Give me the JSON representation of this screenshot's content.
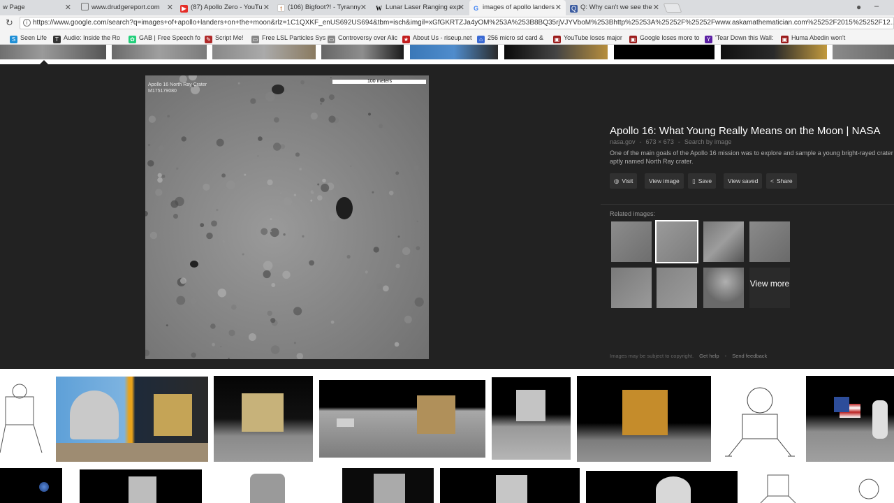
{
  "tabs": [
    {
      "label": "w Page",
      "icon": "blank-page-icon"
    },
    {
      "label": "www.drudgereport.com",
      "icon": "document-icon"
    },
    {
      "label": "(87) Apollo Zero - YouTu",
      "icon": "youtube-icon"
    },
    {
      "label": "(106) Bigfoot?! - Tyranny",
      "icon": "tumblr-icon"
    },
    {
      "label": "Lunar Laser Ranging exp",
      "icon": "wikipedia-icon"
    },
    {
      "label": "images of apollo landers",
      "icon": "google-icon"
    },
    {
      "label": "Q: Why can't we see the",
      "icon": "mathematician-icon"
    }
  ],
  "address": {
    "url": "https://www.google.com/search?q=images+of+apollo+landers+on+the+moon&rlz=1C1QXKF_enUS692US694&tbm=isch&imgil=xGfGKRTZJa4yOM%253A%253B8BQ35rjVJYVboM%253Bhttp%25253A%25252F%25252Fwww.askamathematician.com%25252F2015%25252F12..."
  },
  "bookmarks": [
    {
      "label": "Seen Life",
      "color": "#1e8fd6",
      "icon": "skype-icon"
    },
    {
      "label": "Audio: Inside the Ro",
      "color": "#333333",
      "icon": "t-logo-icon"
    },
    {
      "label": "GAB | Free Speech fo",
      "color": "#21cf7a",
      "icon": "gab-frog-icon"
    },
    {
      "label": "Script Me!",
      "color": "#b02a2a",
      "icon": "script-icon"
    },
    {
      "label": "Free LSL Particles Sys",
      "color": "#888888",
      "icon": "page-icon"
    },
    {
      "label": "Controversy over Alic",
      "color": "#888888",
      "icon": "page-icon"
    },
    {
      "label": "About Us - riseup.net",
      "color": "#c31d1d",
      "icon": "riseup-star-icon"
    },
    {
      "label": "256 micro sd card &",
      "color": "#3a6ad4",
      "icon": "home-icon"
    },
    {
      "label": "YouTube loses major",
      "color": "#9b1b1b",
      "icon": "news-icon"
    },
    {
      "label": "Google loses more to",
      "color": "#9b1b1b",
      "icon": "news-icon"
    },
    {
      "label": "'Tear Down this Wall:",
      "color": "#5b1fa3",
      "icon": "yahoo-icon"
    },
    {
      "label": "Huma Abedin won't",
      "color": "#9b1b1b",
      "icon": "news-icon"
    }
  ],
  "viewer": {
    "image_overlay_title": "Apollo 16 North Ray Crater",
    "image_overlay_sub": "M175179080",
    "scale_label": "100 meters",
    "title": "Apollo 16: What Young Really Means on the Moon | NASA",
    "source": "nasa.gov",
    "dimensions": "673 × 673",
    "search_by_image": "Search by image",
    "description": "One of the main goals of the Apollo 16 mission was to explore and sample a young bright-rayed crater aptly named North Ray crater.",
    "buttons": {
      "visit": "Visit",
      "view_image": "View image",
      "save": "Save",
      "view_saved": "View saved",
      "share": "Share"
    },
    "related_label": "Related images:",
    "view_more": "View more",
    "copyright": "Images may be subject to copyright.",
    "get_help": "Get help",
    "send_feedback": "Send feedback"
  },
  "colors": {
    "viewer_bg": "#222222",
    "tabstrip": "#dadcdf",
    "toolbar": "#f4f4f4"
  }
}
